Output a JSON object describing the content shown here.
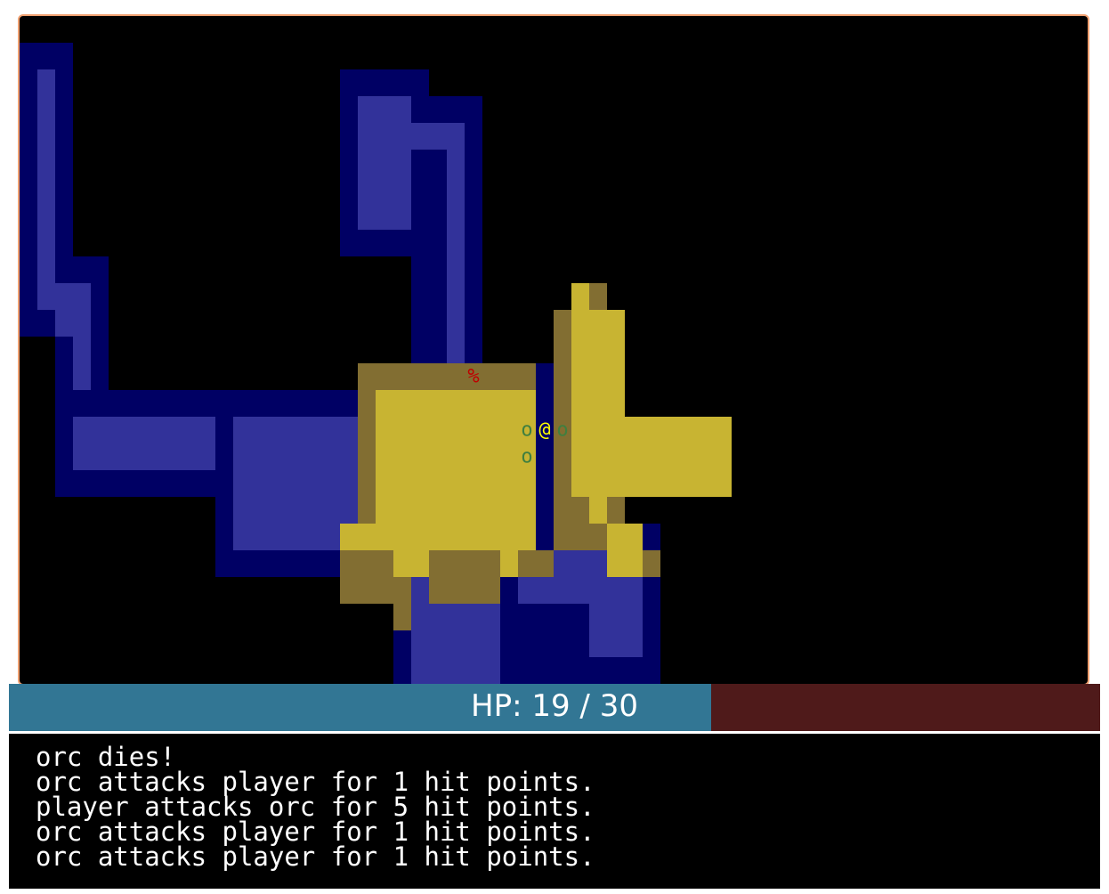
{
  "hud": {
    "hp_text": "HP: 19 / 30",
    "hp_current": 19,
    "hp_max": 30,
    "hp_fill_color": "#327694",
    "hp_empty_color": "#4f1a1a"
  },
  "message_log": [
    "orc dies!",
    "orc attacks player for 1 hit points.",
    "player attacks orc for 5 hit points.",
    "orc attacks player for 1 hit points.",
    "orc attacks player for 1 hit points."
  ],
  "map": {
    "colors": {
      "background": "#000000",
      "explored_wall": "#000064",
      "explored_floor": "#32329a",
      "lit_wall": "#826e32",
      "lit_floor": "#c8b432",
      "player": "#ffff00",
      "orc": "#3f7f3f",
      "corpse": "#bf0000"
    },
    "entities": [
      {
        "name": "corpse",
        "glyph": "%"
      },
      {
        "name": "player",
        "glyph": "@"
      },
      {
        "name": "orc",
        "glyph": "o"
      },
      {
        "name": "orc",
        "glyph": "o"
      },
      {
        "name": "orc",
        "glyph": "o"
      }
    ]
  }
}
